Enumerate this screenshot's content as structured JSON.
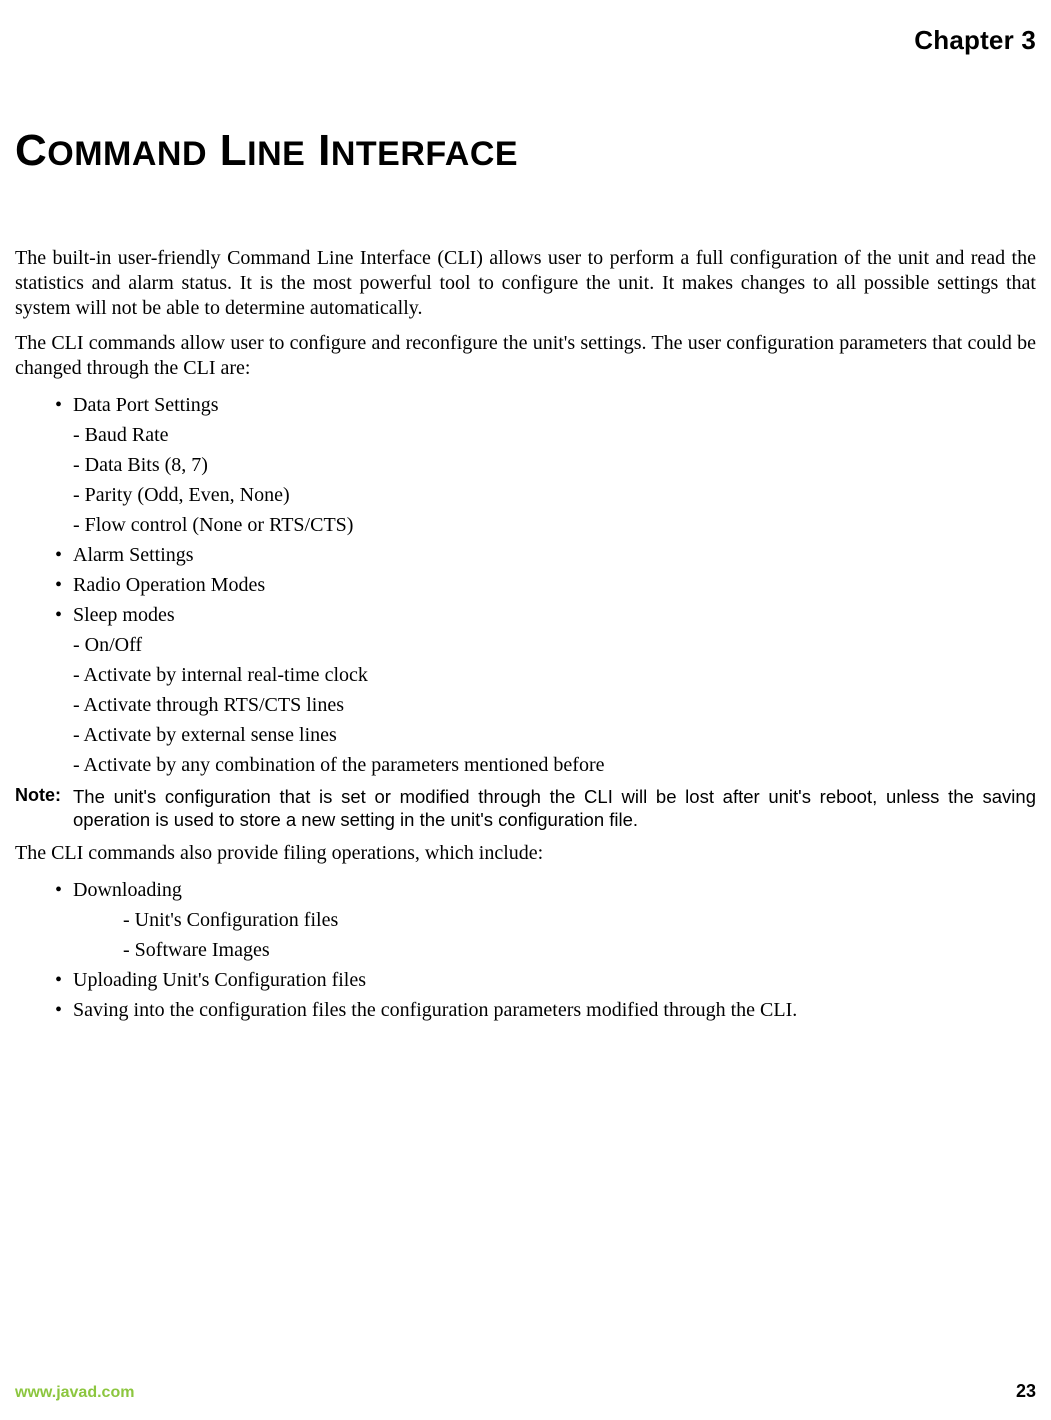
{
  "header": {
    "chapter": "Chapter 3"
  },
  "title_parts": {
    "c1": "C",
    "s1": "OMMAND",
    "sp1": " ",
    "c2": "L",
    "s2": "INE",
    "sp2": " ",
    "c3": "I",
    "s3": "NTERFACE"
  },
  "paragraphs": {
    "p1": "The built-in user-friendly Command Line Interface (CLI) allows user to perform a full configuration of the unit and read the statistics and alarm status. It is the most powerful tool to configure the unit. It makes changes to all possible settings that system will not be able to determine automatically.",
    "p2": "The CLI commands allow user to configure and reconfigure the unit's settings. The user configuration parameters that could be changed through the CLI are:",
    "p3": "The CLI commands also provide filing operations, which include:"
  },
  "list_a": {
    "i1": "Data Port Settings",
    "i1s1": "- Baud Rate",
    "i1s2": "- Data Bits (8, 7)",
    "i1s3": "- Parity (Odd, Even, None)",
    "i1s4": "- Flow control (None or RTS/CTS)",
    "i2": "Alarm Settings",
    "i3": "Radio Operation Modes",
    "i4": "Sleep modes",
    "i4s1": "- On/Off",
    "i4s2": "- Activate by internal real-time clock",
    "i4s3": "- Activate through RTS/CTS lines",
    "i4s4": "- Activate by external sense lines",
    "i4s5": "- Activate by any combination of the parameters mentioned before"
  },
  "note": {
    "label": "Note:",
    "text": "The unit's configuration that is set or modified through the CLI will be lost after unit's reboot, unless the saving operation is used to store a new setting in the unit's configuration file."
  },
  "list_b": {
    "i1": "Downloading",
    "i1s1": "- Unit's Configuration files",
    "i1s2": "- Software Images",
    "i2": "Uploading Unit's Configuration files",
    "i3": "Saving into the configuration files the configuration parameters modified through the CLI."
  },
  "footer": {
    "url": "www.javad.com",
    "page": "23"
  }
}
